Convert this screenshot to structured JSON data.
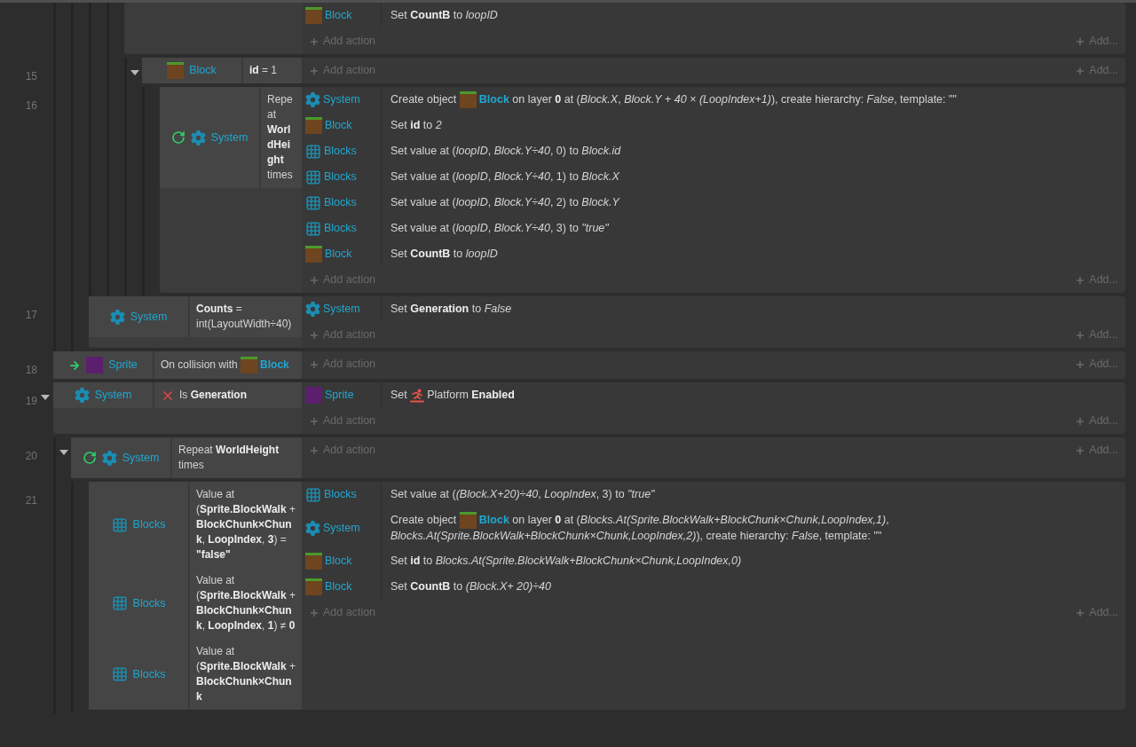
{
  "events": [
    {
      "children": [
        {
          "children": [
            {
              "children": [
                {
                  "children": [
                    {
                      "actions": [
                        {
                          "object": {
                            "kind": "block",
                            "name": "Block"
                          },
                          "parts": [
                            {
                              "kind": "text",
                              "text": "Set **CountB** to *loopID*"
                            }
                          ]
                        }
                      ],
                      "add_action": "Add action",
                      "add_more": "Add...",
                      "children": [
                        {
                          "number": "15",
                          "expanded": true,
                          "conditions": [
                            {
                              "inverted": false,
                              "object": {
                                "kind": "block",
                                "name": "Block"
                              },
                              "parts": [
                                {
                                  "kind": "text",
                                  "text": "**id** = 1"
                                }
                              ]
                            }
                          ],
                          "add_action": "Add action",
                          "add_more": "Add...",
                          "children": [
                            {
                              "number": "16",
                              "conditions": [
                                {
                                  "kind": "loop",
                                  "inverted": false,
                                  "object": {
                                    "kind": "system",
                                    "name": "System"
                                  },
                                  "parts": [
                                    {
                                      "kind": "text",
                                      "text": "Repeat **WorldHeight** times"
                                    }
                                  ]
                                }
                              ],
                              "actions": [
                                {
                                  "object": {
                                    "kind": "system",
                                    "name": "System"
                                  },
                                  "parts": [
                                    {
                                      "kind": "text",
                                      "text": "Create object "
                                    },
                                    {
                                      "kind": "object",
                                      "object": {
                                        "kind": "block",
                                        "name": "Block"
                                      }
                                    },
                                    {
                                      "kind": "text",
                                      "text": " on layer **0** at (*Block.X*, *Block.Y* + *40* × *(LoopIndex+1)*), create hierarchy: *False*, template: \"\""
                                    }
                                  ]
                                },
                                {
                                  "object": {
                                    "kind": "block",
                                    "name": "Block"
                                  },
                                  "parts": [
                                    {
                                      "kind": "text",
                                      "text": "Set **id** to *2*"
                                    }
                                  ]
                                },
                                {
                                  "object": {
                                    "kind": "array",
                                    "name": "Blocks"
                                  },
                                  "parts": [
                                    {
                                      "kind": "text",
                                      "text": "Set value at (*loopID*, *Block.Y÷40*, 0) to *Block.id*"
                                    }
                                  ]
                                },
                                {
                                  "object": {
                                    "kind": "array",
                                    "name": "Blocks"
                                  },
                                  "parts": [
                                    {
                                      "kind": "text",
                                      "text": "Set value at (*loopID*, *Block.Y÷40*, 1) to *Block.X*"
                                    }
                                  ]
                                },
                                {
                                  "object": {
                                    "kind": "array",
                                    "name": "Blocks"
                                  },
                                  "parts": [
                                    {
                                      "kind": "text",
                                      "text": "Set value at (*loopID*, *Block.Y÷40*, 2) to *Block.Y*"
                                    }
                                  ]
                                },
                                {
                                  "object": {
                                    "kind": "array",
                                    "name": "Blocks"
                                  },
                                  "parts": [
                                    {
                                      "kind": "text",
                                      "text": "Set value at (*loopID*, *Block.Y÷40*, 3) to *\"true\"*"
                                    }
                                  ]
                                },
                                {
                                  "object": {
                                    "kind": "block",
                                    "name": "Block"
                                  },
                                  "parts": [
                                    {
                                      "kind": "text",
                                      "text": "Set **CountB** to *loopID*"
                                    }
                                  ]
                                }
                              ],
                              "add_action": "Add action",
                              "add_more": "Add..."
                            }
                          ]
                        }
                      ]
                    }
                  ]
                }
              ]
            },
            {
              "number": "17",
              "conditions": [
                {
                  "inverted": false,
                  "object": {
                    "kind": "system",
                    "name": "System"
                  },
                  "parts": [
                    {
                      "kind": "text",
                      "text": "**Counts** = int(LayoutWidth÷40)"
                    }
                  ]
                }
              ],
              "actions": [
                {
                  "object": {
                    "kind": "system",
                    "name": "System"
                  },
                  "parts": [
                    {
                      "kind": "text",
                      "text": "Set **Generation** to *False*"
                    }
                  ]
                }
              ],
              "add_action": "Add action",
              "add_more": "Add..."
            }
          ]
        }
      ]
    },
    {
      "number": "18",
      "conditions": [
        {
          "kind": "trigger",
          "inverted": false,
          "object": {
            "kind": "sprite",
            "name": "Sprite"
          },
          "parts": [
            {
              "kind": "text",
              "text": "On collision with "
            },
            {
              "kind": "object",
              "object": {
                "kind": "block",
                "name": "Block"
              }
            }
          ]
        }
      ],
      "add_action": "Add action",
      "add_more": "Add..."
    },
    {
      "number": "19",
      "expanded": true,
      "conditions": [
        {
          "inverted": true,
          "object": {
            "kind": "system",
            "name": "System"
          },
          "parts": [
            {
              "kind": "text",
              "text": "Is **Generation**"
            }
          ]
        }
      ],
      "actions": [
        {
          "object": {
            "kind": "sprite",
            "name": "Sprite"
          },
          "parts": [
            {
              "kind": "text",
              "text": "Set "
            },
            {
              "kind": "behavior",
              "behavior": {
                "kind": "platform",
                "name": "Platform"
              }
            },
            {
              "kind": "text",
              "text": " **Enabled**"
            }
          ]
        }
      ],
      "add_action": "Add action",
      "add_more": "Add...",
      "children": [
        {
          "number": "20",
          "expanded": true,
          "conditions": [
            {
              "kind": "loop",
              "inverted": false,
              "object": {
                "kind": "system",
                "name": "System"
              },
              "parts": [
                {
                  "kind": "text",
                  "text": "Repeat **WorldHeight** times"
                }
              ]
            }
          ],
          "add_action": "Add action",
          "add_more": "Add...",
          "children": [
            {
              "number": "21",
              "conditions": [
                {
                  "inverted": false,
                  "object": {
                    "kind": "array",
                    "name": "Blocks"
                  },
                  "parts": [
                    {
                      "kind": "text",
                      "text": "Value at (**Sprite.BlockWalk** + **BlockChunk×Chunk**, **LoopIndex**, **3**) = **\"false\"**"
                    }
                  ]
                },
                {
                  "inverted": false,
                  "object": {
                    "kind": "array",
                    "name": "Blocks"
                  },
                  "parts": [
                    {
                      "kind": "text",
                      "text": "Value at (**Sprite.BlockWalk** + **BlockChunk×Chunk**, **LoopIndex**, **1**) ≠ **0**"
                    }
                  ]
                },
                {
                  "inverted": false,
                  "object": {
                    "kind": "array",
                    "name": "Blocks"
                  },
                  "parts": [
                    {
                      "kind": "text",
                      "text": "Value at (**Sprite.BlockWalk** + **BlockChunk×Chunk**"
                    }
                  ]
                }
              ],
              "actions": [
                {
                  "object": {
                    "kind": "array",
                    "name": "Blocks"
                  },
                  "parts": [
                    {
                      "kind": "text",
                      "text": "Set value at (*(Block.X+20)÷40*, *LoopIndex*, 3) to *\"true\"*"
                    }
                  ]
                },
                {
                  "object": {
                    "kind": "system",
                    "name": "System"
                  },
                  "parts": [
                    {
                      "kind": "text",
                      "text": "Create object "
                    },
                    {
                      "kind": "object",
                      "object": {
                        "kind": "block",
                        "name": "Block"
                      }
                    },
                    {
                      "kind": "text",
                      "text": " on layer **0** at (*Blocks.At(Sprite.BlockWalk+BlockChunk×Chunk,LoopIndex,1)*, *Blocks.At(Sprite.BlockWalk+BlockChunk×Chunk,LoopIndex,2)*), create hierarchy: *False*, template: \"\""
                    }
                  ]
                },
                {
                  "object": {
                    "kind": "block",
                    "name": "Block"
                  },
                  "parts": [
                    {
                      "kind": "text",
                      "text": "Set **id** to *Blocks.At(Sprite.BlockWalk+BlockChunk×Chunk,LoopIndex,0)*"
                    }
                  ]
                },
                {
                  "object": {
                    "kind": "block",
                    "name": "Block"
                  },
                  "parts": [
                    {
                      "kind": "text",
                      "text": "Set **CountB** to *(Block.X+ 20)÷40*"
                    }
                  ]
                }
              ],
              "add_action": "Add action",
              "add_more": "Add..."
            }
          ]
        }
      ]
    }
  ]
}
